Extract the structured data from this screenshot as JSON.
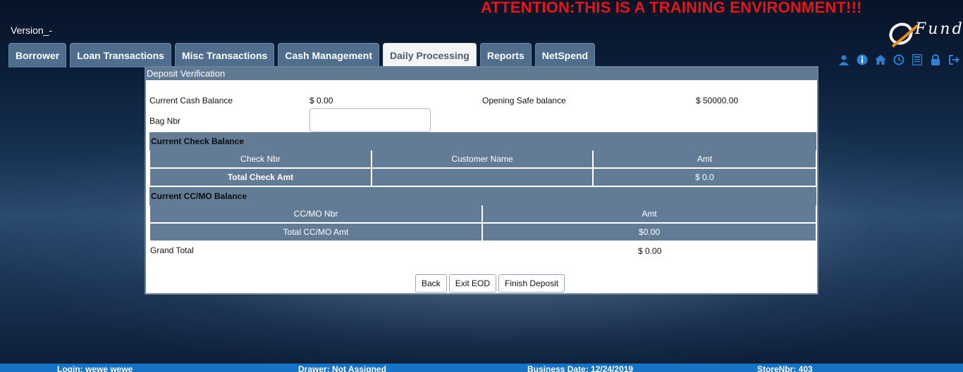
{
  "banner": "ATTENTION:THIS IS A TRAINING ENVIRONMENT!!!",
  "version": "Version_-",
  "logo": {
    "text": "Fund"
  },
  "tabs": [
    {
      "label": "Borrower",
      "active": false
    },
    {
      "label": "Loan Transactions",
      "active": false
    },
    {
      "label": "Misc Transactions",
      "active": false
    },
    {
      "label": "Cash Management",
      "active": false
    },
    {
      "label": "Daily Processing",
      "active": true
    },
    {
      "label": "Reports",
      "active": false
    },
    {
      "label": "NetSpend",
      "active": false
    }
  ],
  "toolbar_icons": [
    "user-icon",
    "info-icon",
    "home-icon",
    "clock-icon",
    "calculator-icon",
    "lock-icon",
    "logout-icon"
  ],
  "panel": {
    "title": "Deposit Verification",
    "current_cash_label": "Current Cash Balance",
    "current_cash_value": "$ 0.00",
    "opening_safe_label": "Opening Safe balance",
    "opening_safe_value": "$ 50000.00",
    "bag_label": "Bag Nbr",
    "bag_value": "",
    "check_section": "Current Check Balance",
    "check_headers": [
      "Check Nbr",
      "Customer Name",
      "Amt"
    ],
    "check_total_label": "Total Check Amt",
    "check_total_value": "$ 0.0",
    "ccmo_section": "Current CC/MO Balance",
    "ccmo_headers": [
      "CC/MO Nbr",
      "Amt"
    ],
    "ccmo_total_label": "Total CC/MO Amt",
    "ccmo_total_value": "$0.00",
    "grand_total_label": "Grand Total",
    "grand_total_value": "$ 0.00",
    "buttons": {
      "back": "Back",
      "exit": "Exit EOD",
      "finish": "Finish Deposit"
    }
  },
  "footer": {
    "login": "Login: wewe wewe",
    "drawer": "Drawer: Not Assigned",
    "business_date": "Business Date: 12/24/2019",
    "store": "StoreNbr: 403"
  },
  "colors": {
    "banner": "#e8141b",
    "tab": "#4f6d8c",
    "header": "#627c96",
    "footer": "#1574c7"
  }
}
